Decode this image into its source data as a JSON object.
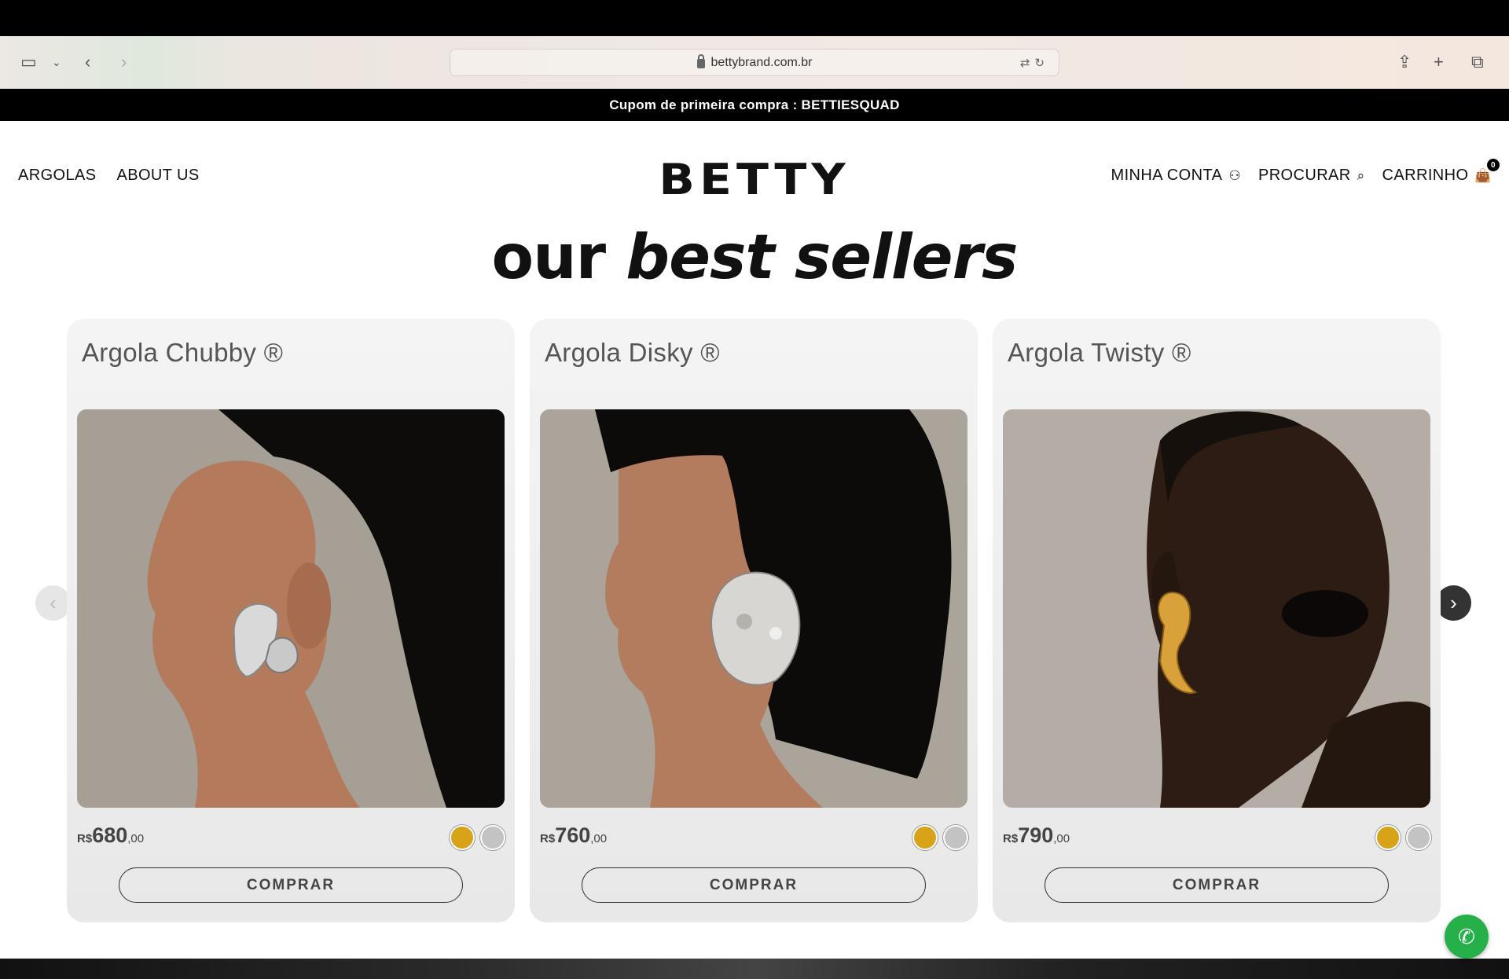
{
  "browser": {
    "url": "bettybrand.com.br"
  },
  "promo": {
    "text": "Cupom de primeira compra : BETTIESQUAD"
  },
  "nav": {
    "left": [
      "ARGOLAS",
      "ABOUT US"
    ],
    "logo": "BETTY",
    "account": "MINHA CONTA",
    "search": "PROCURAR",
    "cart": "CARRINHO",
    "cart_count": "0"
  },
  "section": {
    "title_plain": "our",
    "title_emph": "best sellers"
  },
  "products": [
    {
      "name": "Argola Chubby ®",
      "currency": "R$",
      "price_int": "680",
      "price_dec": ",00",
      "button": "COMPRAR",
      "metal": "silver"
    },
    {
      "name": "Argola Disky ®",
      "currency": "R$",
      "price_int": "760",
      "price_dec": ",00",
      "button": "COMPRAR",
      "metal": "silver"
    },
    {
      "name": "Argola Twisty ®",
      "currency": "R$",
      "price_int": "790",
      "price_dec": ",00",
      "button": "COMPRAR",
      "metal": "gold"
    }
  ],
  "colors": {
    "swatch_gold": "#d8a319",
    "swatch_silver": "#c3c3c3",
    "whatsapp": "#25b04a"
  }
}
